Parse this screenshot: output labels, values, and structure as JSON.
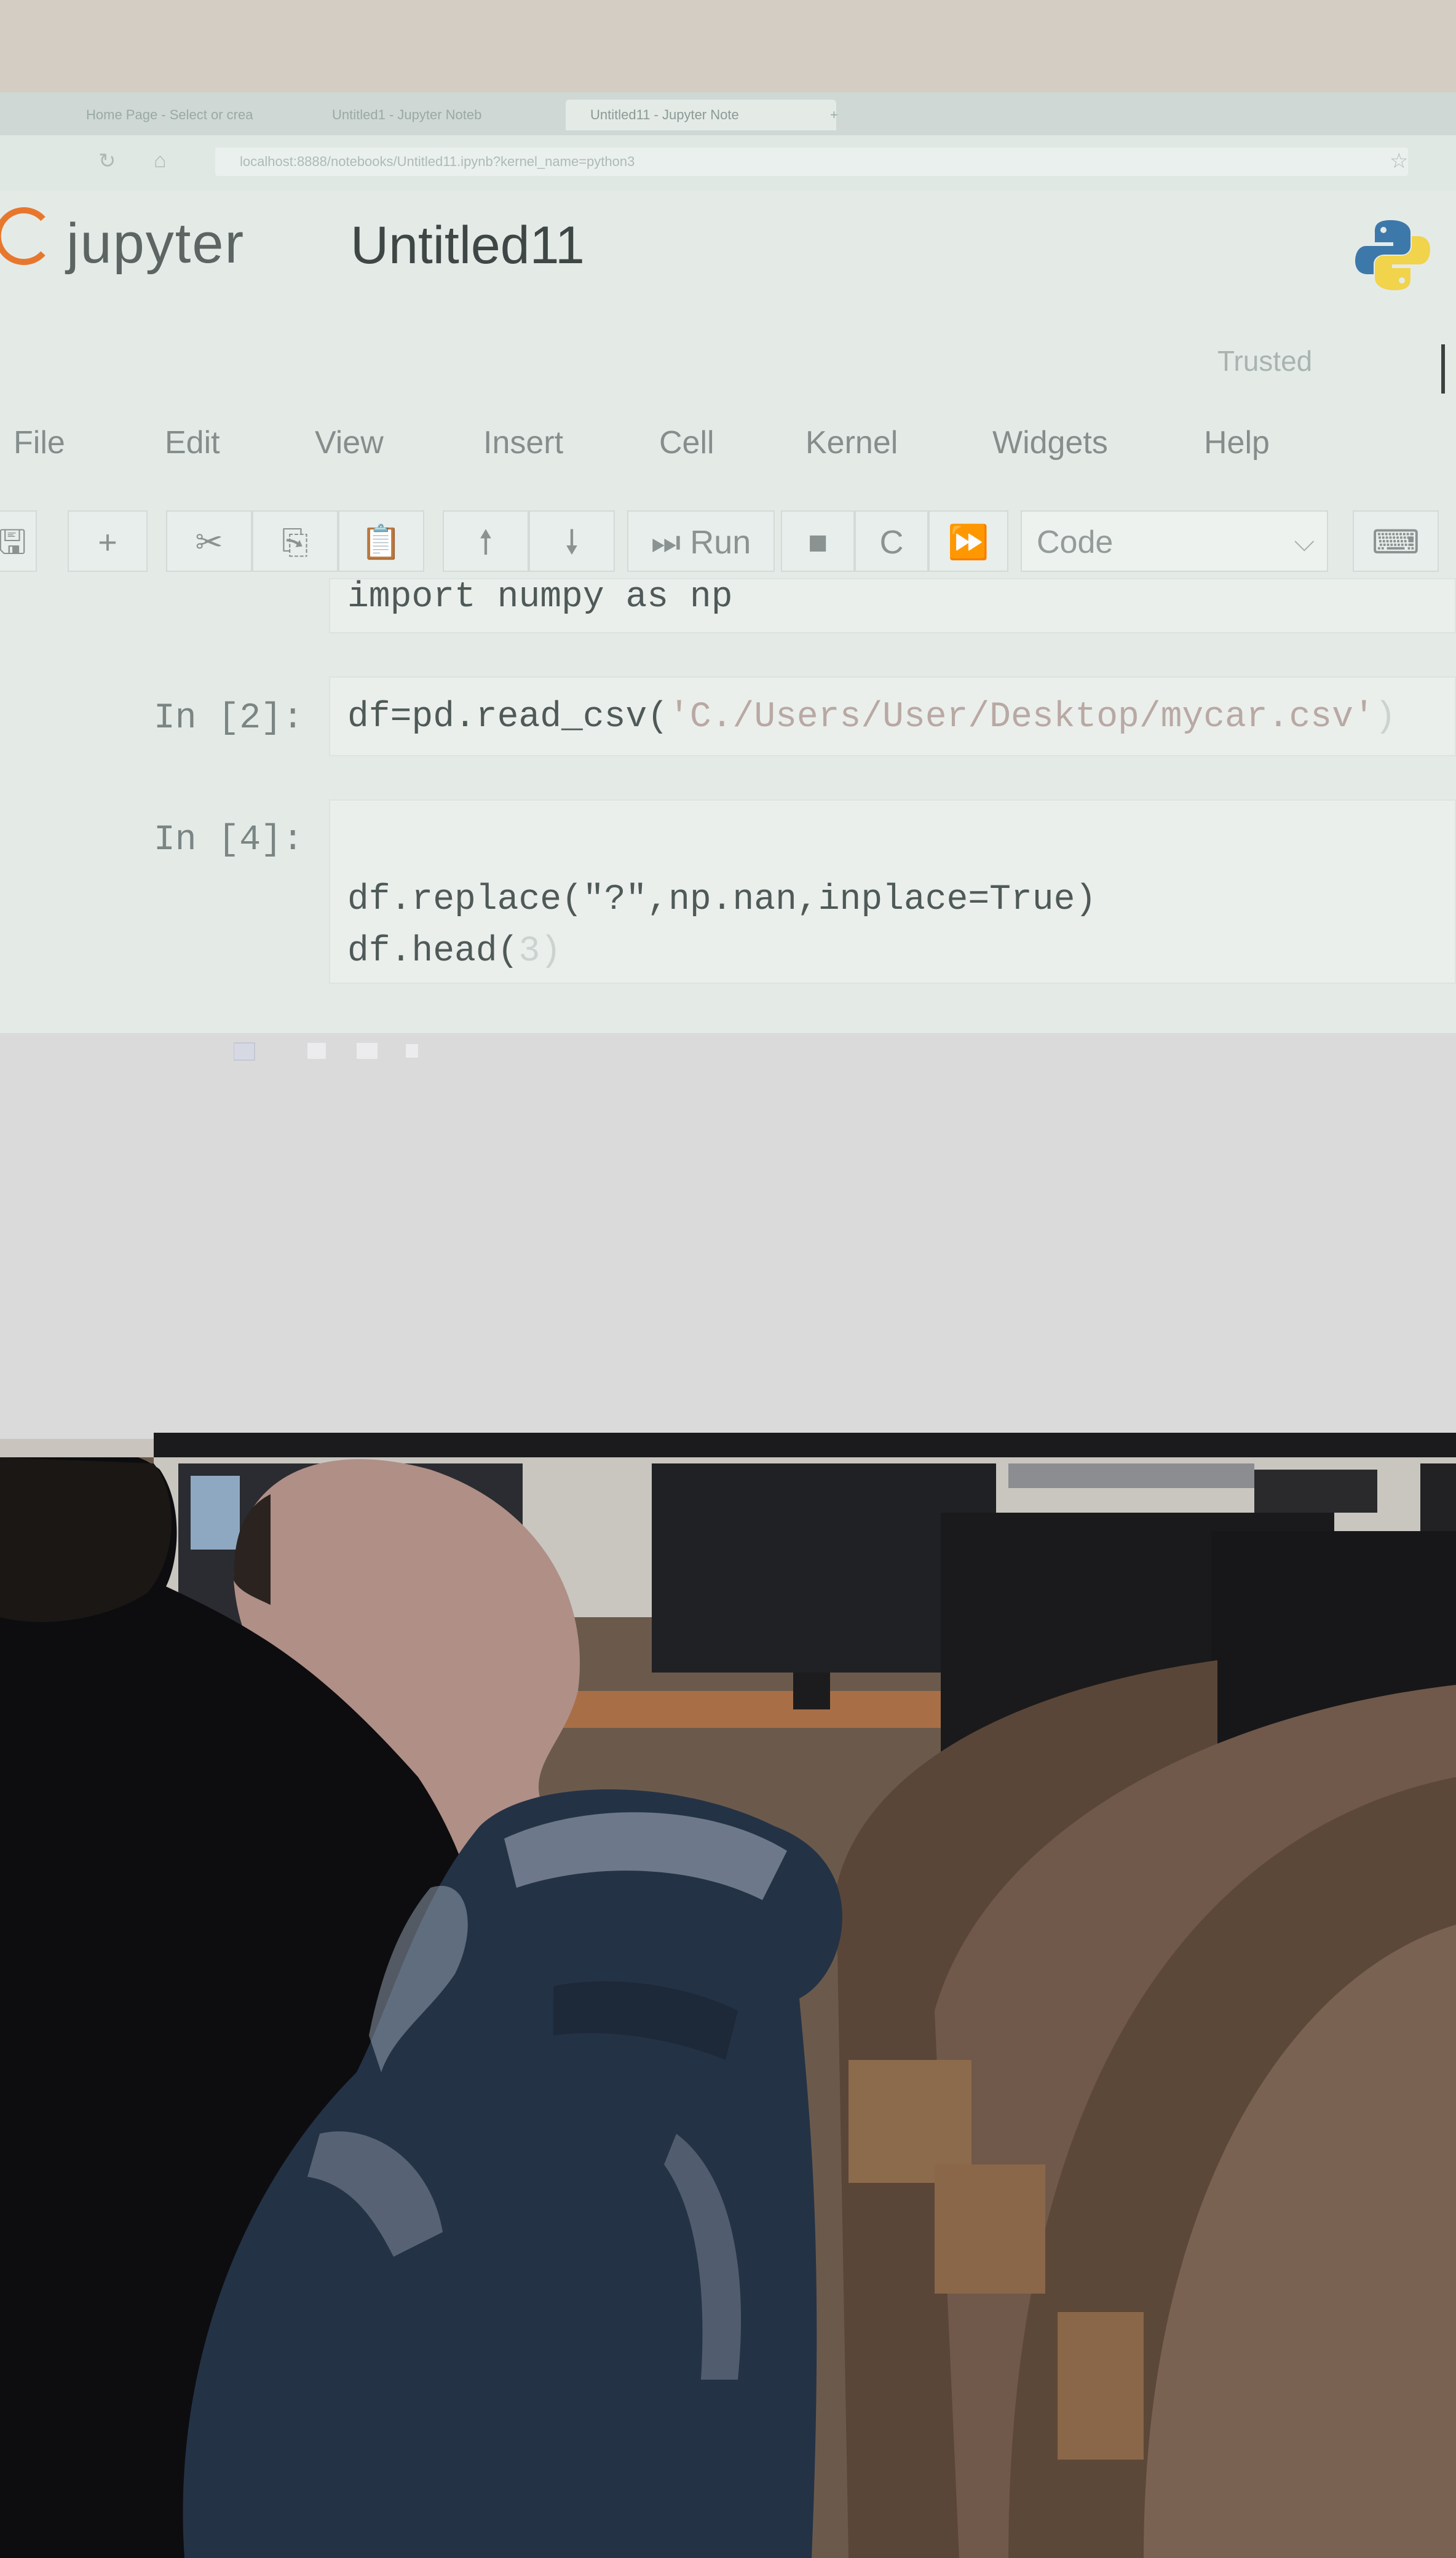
{
  "browser": {
    "tabs": [
      "Home Page - Select or crea",
      "Untitled1 - Jupyter Noteb",
      "Untitled11 - Jupyter Note"
    ],
    "new_tab": "+",
    "url": "localhost:8888/notebooks/Untitled11.ipynb?kernel_name=python3"
  },
  "notebook": {
    "brand": "jupyter",
    "title": "Untitled11",
    "trusted": "Trusted",
    "menu": [
      "File",
      "Edit",
      "View",
      "Insert",
      "Cell",
      "Kernel",
      "Widgets",
      "Help"
    ],
    "toolbar": {
      "run_label": "Run",
      "cell_type": "Code"
    },
    "cells": [
      {
        "prompt": "",
        "code": "import numpy as np"
      },
      {
        "prompt": "In [2]:",
        "code_pre": "df=pd.read_csv(",
        "code_str": "'C./Users/User/Desktop/mycar.csv'",
        "code_post": ")"
      },
      {
        "prompt": "In [4]:",
        "line1": "df.replace(\"?\",np.nan,inplace=True)",
        "line2_pre": "df.head(",
        "line2_num": "3",
        "line2_post": ")"
      }
    ]
  },
  "colors": {
    "screen_bg": "#e4ebe7",
    "jupyter_orange": "#e8772e",
    "python_blue": "#3d78ab",
    "python_yellow": "#f1d34c"
  }
}
